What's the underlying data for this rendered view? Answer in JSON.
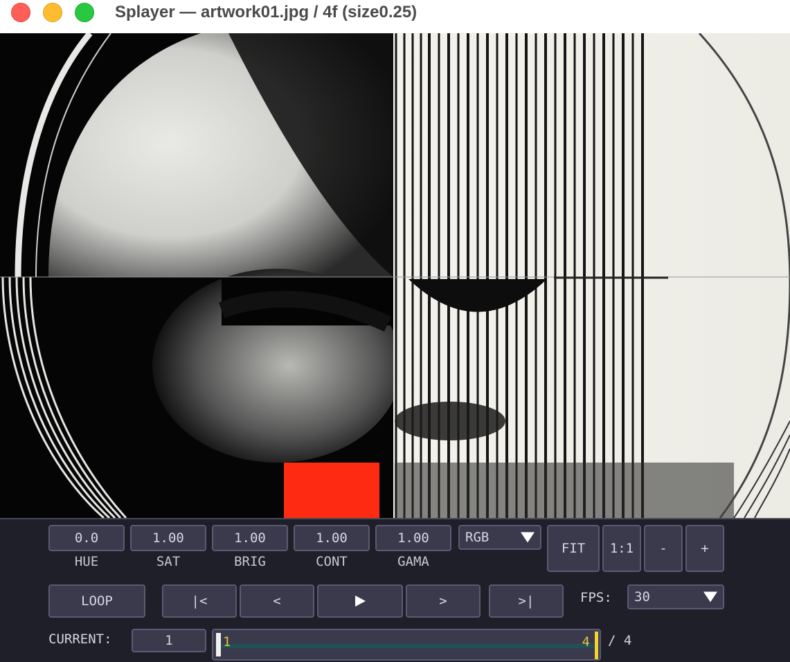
{
  "window": {
    "title": "Splayer — artwork01.jpg / 4f (size0.25)"
  },
  "colors": {
    "close": "#fe5f57",
    "minimize": "#febc2e",
    "maximize": "#28c840",
    "panel_bg": "#1f1f29",
    "control_bg": "#3a3a4c",
    "marker": "#e3c53a",
    "track": "#1e5256",
    "accent_red": "#ff2a12"
  },
  "adjust": {
    "hue": {
      "value": "0.0",
      "label": "HUE"
    },
    "sat": {
      "value": "1.00",
      "label": "SAT"
    },
    "brig": {
      "value": "1.00",
      "label": "BRIG"
    },
    "cont": {
      "value": "1.00",
      "label": "CONT"
    },
    "gama": {
      "value": "1.00",
      "label": "GAMA"
    }
  },
  "channel": {
    "selected": "RGB"
  },
  "view": {
    "fit_label": "FIT",
    "one_to_one_label": "1:1",
    "zoom_out_label": "-",
    "zoom_in_label": "+"
  },
  "playback": {
    "loop_label": "LOOP",
    "first_label": "|<",
    "prev_label": "<",
    "play_icon": "play-icon",
    "next_label": ">",
    "last_label": ">|",
    "fps_label": "FPS:",
    "fps_value": "30"
  },
  "frame": {
    "current_label": "CURRENT:",
    "current_value": "1",
    "range_start": "1",
    "range_end": "4",
    "total": "/ 4"
  }
}
